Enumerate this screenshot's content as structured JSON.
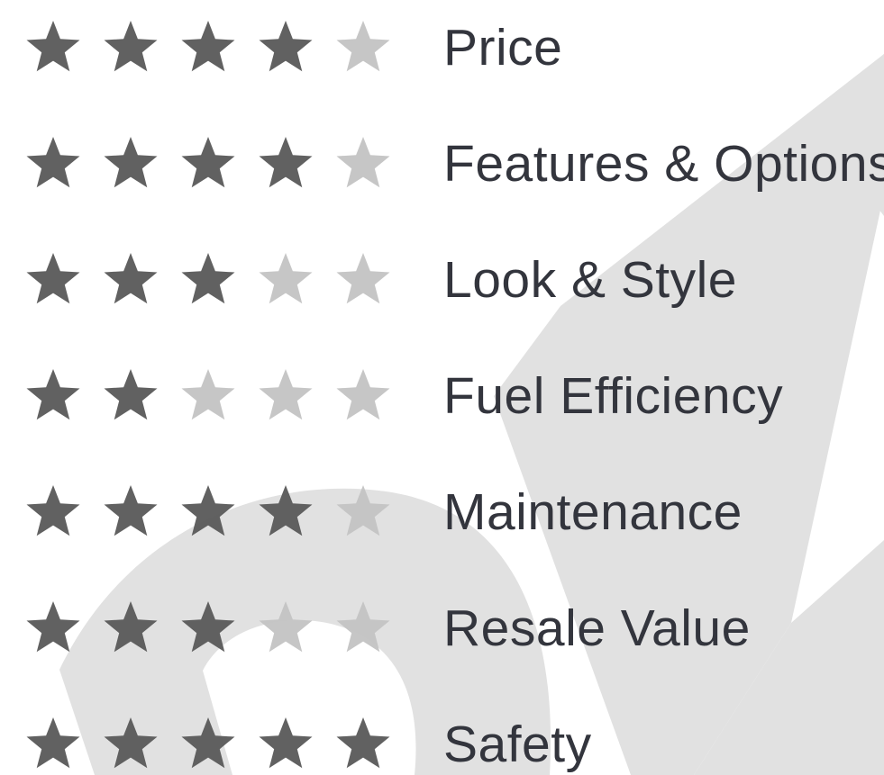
{
  "colors": {
    "star_filled": "#5b5b5b",
    "star_empty": "#c4c4c4",
    "label_text": "#33353d",
    "watermark": "#e1e1e1"
  },
  "icons": {
    "star": "star-icon",
    "watermark": "watermark-logo-shape"
  },
  "rating_scale_max": 5,
  "ratings": [
    {
      "label": "Price",
      "stars": 4
    },
    {
      "label": "Features & Options",
      "stars": 4
    },
    {
      "label": "Look & Style",
      "stars": 3
    },
    {
      "label": "Fuel Efficiency",
      "stars": 2
    },
    {
      "label": "Maintenance",
      "stars": 4
    },
    {
      "label": "Resale Value",
      "stars": 3
    },
    {
      "label": "Safety",
      "stars": 5
    }
  ]
}
